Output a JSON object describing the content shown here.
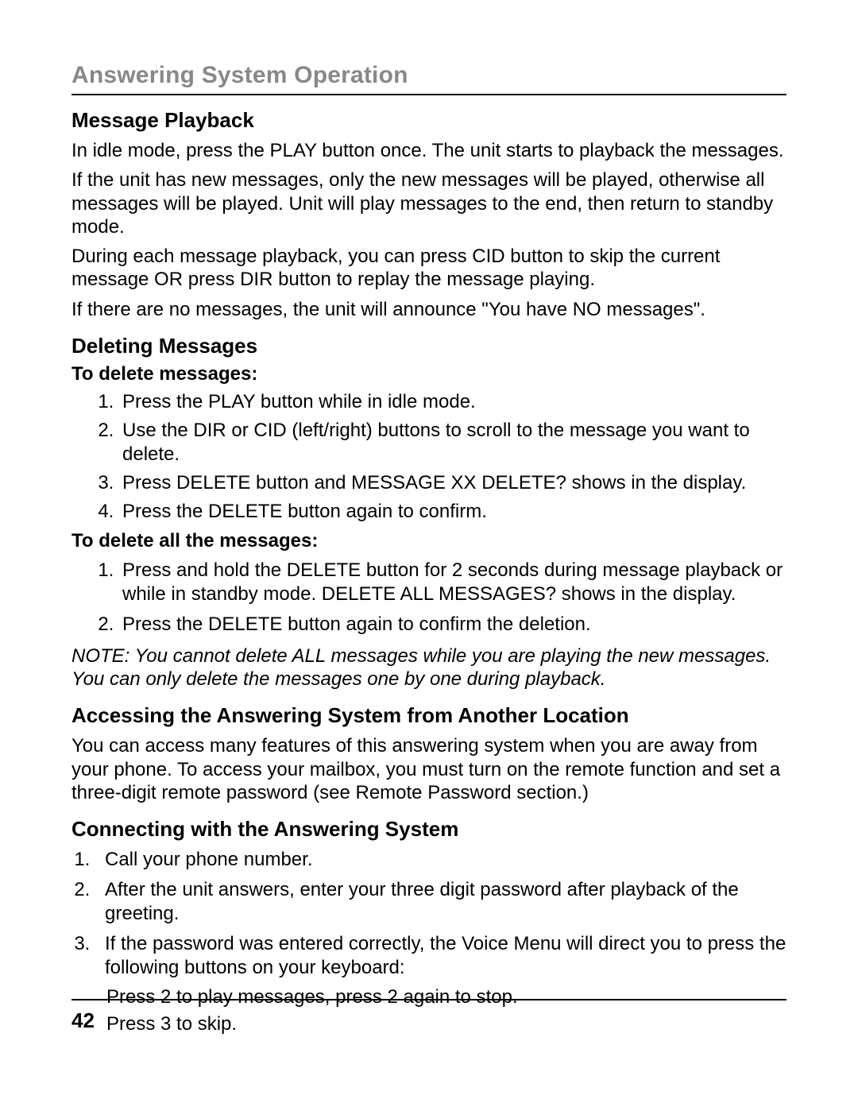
{
  "chapter_title": "Answering System Operation",
  "s1": {
    "title": "Message Playback",
    "p1": "In idle mode, press the PLAY button once. The unit starts to playback the messages.",
    "p2": "If the unit has new messages, only the new messages will be played, otherwise all messages will be played. Unit will play messages to the end, then return to standby mode.",
    "p3": "During each message playback, you can press CID button to skip the current message OR press DIR button to replay the message playing.",
    "p4": "If there are no messages, the unit will announce \"You have NO messages\"."
  },
  "s2": {
    "title": "Deleting Messages",
    "subA": "To delete messages:",
    "listA": {
      "i1": "Press the PLAY button while in idle mode.",
      "i2": "Use the DIR or CID (left/right) buttons to scroll to the message you want to delete.",
      "i3": "Press DELETE button and MESSAGE XX DELETE? shows in the display.",
      "i4": "Press the DELETE button again to confirm."
    },
    "subB": "To delete all the messages:",
    "listB": {
      "i1": "Press and hold the DELETE button for 2 seconds during message playback or while in standby mode. DELETE ALL MESSAGES? shows in the display.",
      "i2": "Press the DELETE button again to confirm the deletion."
    },
    "note": "NOTE: You cannot delete ALL messages while you are playing the new messages. You can only delete the messages one by one during playback."
  },
  "s3": {
    "title": "Accessing the Answering System from Another Location",
    "p1": "You can access many features of this answering system when you are away from your phone. To access your mailbox, you must turn on the remote function and set a three-digit remote password (see Remote Password section.)"
  },
  "s4": {
    "title": "Connecting with the Answering System",
    "list": {
      "i1": "Call your phone number.",
      "i2": "After the unit answers, enter your three digit password after playback of the greeting.",
      "i3": "If the password was entered correctly, the Voice Menu will direct you to press the following buttons on your keyboard:"
    },
    "voiceA": "Press 2 to play messages, press 2 again to stop.",
    "voiceB": "Press 3 to skip."
  },
  "page_number": "42"
}
